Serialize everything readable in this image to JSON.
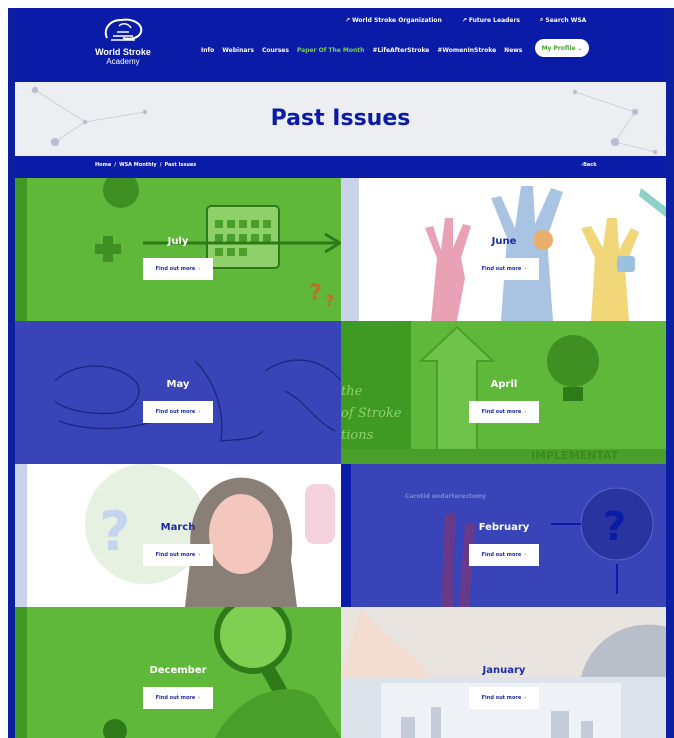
{
  "header": {
    "logo_line1": "World Stroke",
    "logo_line2": "Academy",
    "top_links": [
      {
        "label": "World Stroke Organization"
      },
      {
        "label": "Future Leaders"
      },
      {
        "label": "Search WSA"
      }
    ],
    "nav": [
      {
        "label": "Info"
      },
      {
        "label": "Webinars"
      },
      {
        "label": "Courses"
      },
      {
        "label": "Paper Of The Month"
      },
      {
        "label": "#LifeAfterStroke"
      },
      {
        "label": "#WomenInStroke"
      },
      {
        "label": "News"
      }
    ],
    "profile_label": "My Profile"
  },
  "hero": {
    "title": "Past Issues"
  },
  "breadcrumb": {
    "items": [
      "Home",
      "WSA Monthly",
      "Past Issues"
    ],
    "separator": "/",
    "back_label": "Back"
  },
  "tiles": [
    {
      "month": "July",
      "button": "Find out more",
      "color": "#5fb83a"
    },
    {
      "month": "June",
      "button": "Find out more",
      "color": "#ffffff"
    },
    {
      "month": "May",
      "button": "Find out more",
      "color": "#3944b8"
    },
    {
      "month": "April",
      "button": "Find out more",
      "color": "#5fb83a"
    },
    {
      "month": "March",
      "button": "Find out more",
      "color": "#ffffff"
    },
    {
      "month": "February",
      "button": "Find out more",
      "color": "#3944b8"
    },
    {
      "month": "December",
      "button": "Find out more",
      "color": "#5fb83a"
    },
    {
      "month": "January",
      "button": "Find out more",
      "color": "#ffffff"
    }
  ],
  "tile_decor_text": {
    "april_word": "IMPLEMENTAT",
    "february_heading": "Carotid endarterectomy",
    "april_side_text": [
      "the",
      "of Stroke",
      "tions"
    ]
  },
  "colors": {
    "brand_blue": "#0a1ba8",
    "brand_green": "#5fb83a",
    "tile_blue": "#3944b8"
  }
}
